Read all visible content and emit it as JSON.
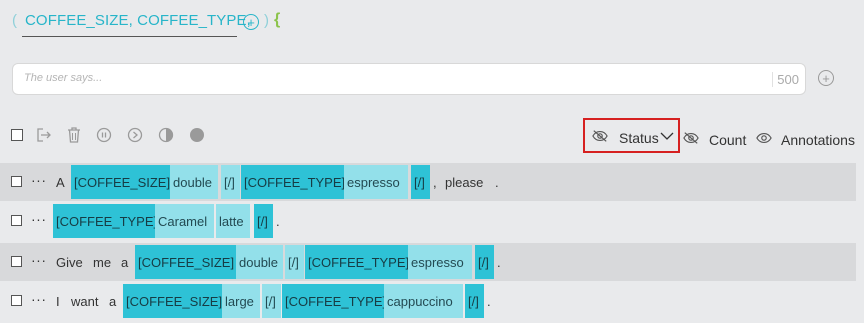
{
  "header": {
    "open_paren": "(",
    "slots_text": "COFFEE_SIZE, COFFEE_TYPE,",
    "close_paren": ")",
    "open_brace": "{"
  },
  "input": {
    "placeholder": "The user says...",
    "char_count": "500"
  },
  "toolbar": {
    "status_label": "Status",
    "count_label": "Count",
    "annotations_label": "Annotations"
  },
  "rows": [
    {
      "tokens": [
        "A",
        "[COFFEE_SIZE]",
        "double",
        "[/]",
        "[COFFEE_TYPE]",
        "espresso",
        "[/]",
        ",",
        "please",
        "."
      ]
    },
    {
      "tokens": [
        "[COFFEE_TYPE]",
        "Caramel",
        "latte",
        "[/]",
        "."
      ]
    },
    {
      "tokens": [
        "Give",
        "me",
        "a",
        "[COFFEE_SIZE]",
        "double",
        "[/]",
        "[COFFEE_TYPE]",
        "espresso",
        "[/]",
        "."
      ]
    },
    {
      "tokens": [
        "I",
        "want",
        "a",
        "[COFFEE_SIZE]",
        "large",
        "[/]",
        "[COFFEE_TYPE]",
        "cappuccino",
        "[/]",
        "."
      ]
    }
  ],
  "row_dots": "···",
  "colors": {
    "accent": "#27b5c9",
    "tag_dark": "#2ec2d6",
    "tag_light": "#93e0ea",
    "brace": "#8bc34a",
    "highlight_border": "#d62020"
  }
}
